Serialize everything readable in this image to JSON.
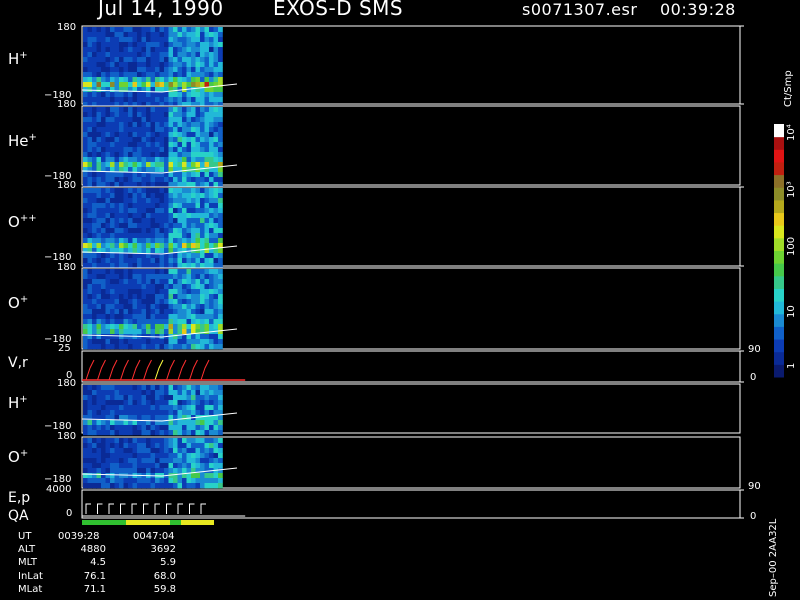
{
  "header": {
    "date": "Jul 14, 1990",
    "instrument": "EXOS-D SMS",
    "file": "s0071307.esr",
    "time": "00:39:28"
  },
  "panels": [
    {
      "label_base": "H",
      "label_sup": "+",
      "tick_top": "180",
      "tick_bottom": "−180"
    },
    {
      "label_base": "He",
      "label_sup": "+",
      "tick_top": "180",
      "tick_bottom": "−180"
    },
    {
      "label_base": "O",
      "label_sup": "++",
      "tick_top": "180",
      "tick_bottom": "−180"
    },
    {
      "label_base": "O",
      "label_sup": "+",
      "tick_top": "180",
      "tick_bottom": "−180"
    },
    {
      "label_base": "V,r",
      "label_sup": "",
      "tick_top": "25",
      "tick_bottom": "0",
      "right_top": "90",
      "right_bottom": "0"
    },
    {
      "label_base": "H",
      "label_sup": "+",
      "tick_top": "180",
      "tick_bottom": "−180"
    },
    {
      "label_base": "O",
      "label_sup": "+",
      "tick_top": "180",
      "tick_bottom": "−180"
    },
    {
      "label_base": "E,p",
      "label_sup": "",
      "label2": "QA",
      "tick_top": "4000",
      "tick_bottom": "0",
      "right_top": "90",
      "right_bottom": "0"
    }
  ],
  "colorbar": {
    "title": "Ct/Smp",
    "ticks": [
      "1",
      "10",
      "100",
      "10³",
      "10⁴"
    ],
    "colors": [
      "#0a1a6e",
      "#0a2a96",
      "#0c3cb4",
      "#1060c8",
      "#1a8ad2",
      "#22b8d8",
      "#28d2c8",
      "#36c88a",
      "#46c84a",
      "#6ed232",
      "#a0dc28",
      "#d8e61e",
      "#e8c81a",
      "#b4a81c",
      "#8c8c28",
      "#8c7028",
      "#c02010",
      "#e01414",
      "#a81010",
      "#ffffff"
    ]
  },
  "table": {
    "ut_label": "UT",
    "ut1": "0039:28",
    "ut2": "0047:04",
    "rows": [
      {
        "k": "ALT",
        "v1": "4880",
        "v2": "3692"
      },
      {
        "k": "MLT",
        "v1": "4.5",
        "v2": "5.9"
      },
      {
        "k": "InLat",
        "v1": "76.1",
        "v2": "68.0"
      },
      {
        "k": "MLat",
        "v1": "71.1",
        "v2": "59.8"
      }
    ]
  },
  "footer": "Sep–00 2AA32L",
  "chart_data": {
    "type": "heatmap",
    "title": "Jul 14, 1990   EXOS-D SMS",
    "time_range": [
      "0039:28",
      "0047:04"
    ],
    "data_time_fraction": 0.21,
    "spectrograms": [
      {
        "species": "H+",
        "ylim": [
          -180,
          180
        ],
        "level": "high"
      },
      {
        "species": "He+",
        "ylim": [
          -180,
          180
        ],
        "level": "medium"
      },
      {
        "species": "O++",
        "ylim": [
          -180,
          180
        ],
        "level": "medium"
      },
      {
        "species": "O+",
        "ylim": [
          -180,
          180
        ],
        "level": "medium"
      },
      {
        "species": "H+",
        "ylim": [
          -180,
          180
        ],
        "level": "low"
      },
      {
        "species": "O+",
        "ylim": [
          -180,
          180
        ],
        "level": "low"
      }
    ],
    "line_panels": [
      {
        "name": "V,r",
        "ylim_left": [
          0,
          25
        ],
        "ylim_right": [
          0,
          90
        ]
      },
      {
        "name": "E,p",
        "ylim_left": [
          0,
          4000
        ],
        "ylim_right": [
          0,
          90
        ]
      }
    ],
    "colorbar": {
      "label": "Ct/Smp",
      "scale": "log",
      "range": [
        1,
        10000
      ]
    }
  }
}
